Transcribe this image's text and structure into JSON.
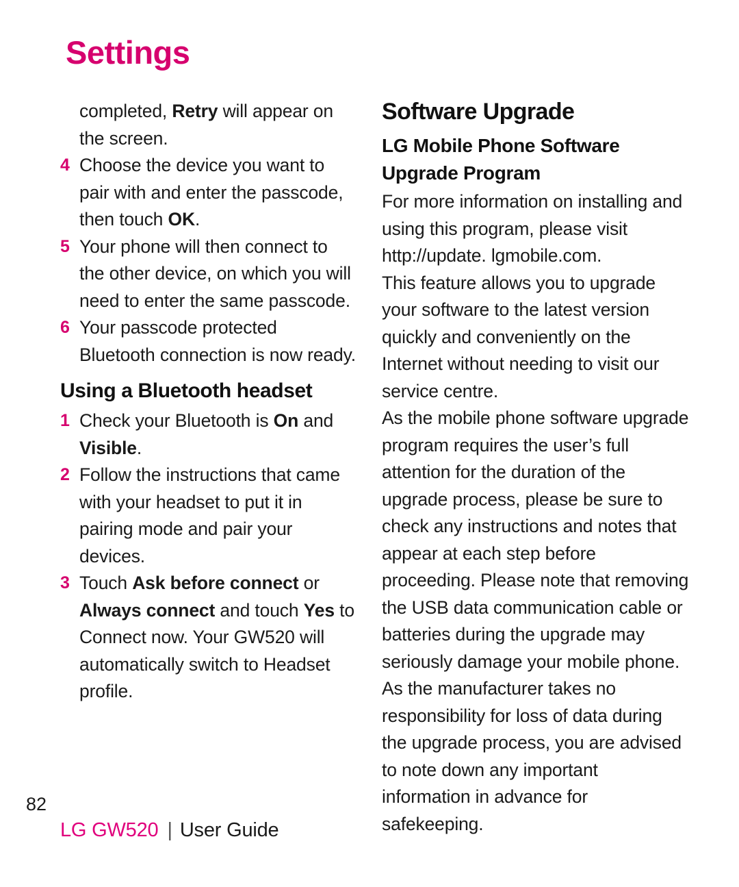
{
  "page": {
    "title": "Settings",
    "number": "82",
    "accent_color": "#d6006e",
    "text_color": "#1a1a1a"
  },
  "left_column": {
    "continuation": {
      "pre": "completed, ",
      "bold": "Retry",
      "post": " will appear on the screen."
    },
    "steps_bluetooth": [
      {
        "num": "4",
        "pre": "Choose the device you want to pair with and enter the passcode, then touch ",
        "bold": "OK",
        "post": "."
      },
      {
        "num": "5",
        "pre": "Your phone will then connect to the other device, on which you will need to enter the same passcode.",
        "bold": "",
        "post": ""
      },
      {
        "num": "6",
        "pre": "Your passcode protected Bluetooth connection is now ready.",
        "bold": "",
        "post": ""
      }
    ],
    "section_heading": "Using a Bluetooth headset",
    "steps_headset": [
      {
        "num": "1",
        "t1": "Check your Bluetooth is ",
        "b1": "On",
        "t2": " and ",
        "b2": "Visible",
        "t3": "."
      },
      {
        "num": "2",
        "t1": "Follow the instructions that came with your headset to put it in pairing mode and pair your devices.",
        "b1": "",
        "t2": "",
        "b2": "",
        "t3": ""
      },
      {
        "num": "3",
        "t1": "Touch ",
        "b1": "Ask before connect",
        "t2": " or ",
        "b2": "Always connect",
        "t3": " and touch ",
        "b3": "Yes",
        "t4": " to Connect now. Your GW520 will automatically switch to Headset profile."
      }
    ]
  },
  "right_column": {
    "heading": "Software Upgrade",
    "subheading": "LG Mobile Phone Software Upgrade Program",
    "paragraphs": [
      "For more information on installing and using this program, please visit http://update. lgmobile.com.",
      "This feature allows you to upgrade your software to the latest version quickly and conveniently on the Internet without needing to visit our service centre.",
      "As the mobile phone software upgrade program requires the user’s full attention for the duration of the upgrade process, please be sure to check any instructions and notes that appear at each step before proceeding. Please note that removing the USB data communication cable or batteries during the upgrade may seriously damage your mobile phone. As the manufacturer takes no responsibility for loss of data during the upgrade process, you are advised to note down any important information in advance for safekeeping."
    ]
  },
  "footer": {
    "brand": "LG GW520",
    "separator": "|",
    "guide": "User Guide"
  }
}
